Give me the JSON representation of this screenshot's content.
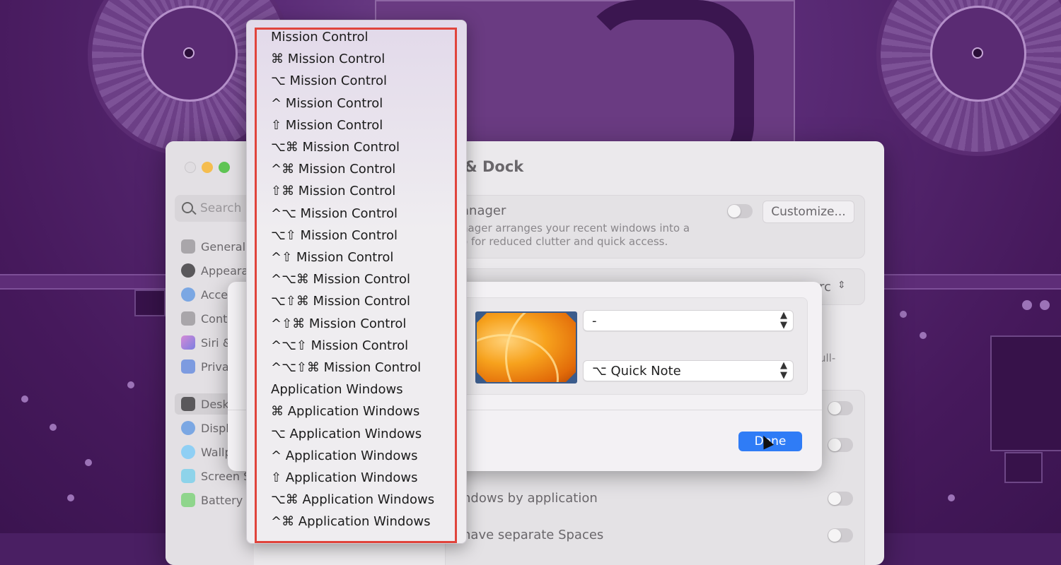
{
  "window": {
    "title": "Desktop & Dock",
    "title_visible": "p & Dock",
    "search_placeholder": "Search",
    "sidebar": [
      {
        "label": "General",
        "icon": "gear-icon",
        "color": "#a9a6aa"
      },
      {
        "label": "Appearance",
        "icon": "appearance-icon",
        "color": "#3c3c3c"
      },
      {
        "label": "Accessibility",
        "icon": "accessibility-icon",
        "color": "#3a86e8"
      },
      {
        "label": "Control Centre",
        "icon": "control-centre-icon",
        "color": "#a9a6aa"
      },
      {
        "label": "Siri & Spotlight",
        "icon": "siri-icon",
        "color": "#b157d8"
      },
      {
        "label": "Privacy & Security",
        "icon": "hand-icon",
        "color": "#4e7fe0"
      },
      {
        "label": "Desktop & Dock",
        "icon": "dock-icon",
        "color": "#3c3c3c"
      },
      {
        "label": "Displays",
        "icon": "display-icon",
        "color": "#3a86e8"
      },
      {
        "label": "Wallpaper",
        "icon": "wallpaper-icon",
        "color": "#56b9f2"
      },
      {
        "label": "Screen Saver",
        "icon": "screen-saver-icon",
        "color": "#55c0e4"
      },
      {
        "label": "Battery",
        "icon": "battery-icon",
        "color": "#56c452"
      }
    ],
    "sidebar_visible": [
      "General",
      "Appeara",
      "Acce",
      "Cont",
      "Siri &",
      "Priva",
      "Desk",
      "Displ",
      "Wallp",
      "Screen S",
      "Battery"
    ],
    "stage_manager": {
      "heading": "anager",
      "desc_line1": "nager arranges your recent windows into a",
      "desc_line2": "o for reduced clutter and quick access.",
      "customize_label": "Customize..."
    },
    "click_row_value": "rc",
    "side_text": "ull-",
    "group_windows_label": "ndows by application",
    "separate_spaces_label": "have separate Spaces"
  },
  "hot_corners": {
    "top_right_value": "-",
    "bottom_right_value": "⌥ Quick Note",
    "done_label": "Done"
  },
  "menu_items": [
    " Mission Control",
    "⌘ Mission Control",
    "⌥ Mission Control",
    "^ Mission Control",
    "⇧ Mission Control",
    "⌥⌘ Mission Control",
    "^⌘ Mission Control",
    "⇧⌘ Mission Control",
    "^⌥ Mission Control",
    "⌥⇧ Mission Control",
    "^⇧ Mission Control",
    "^⌥⌘ Mission Control",
    "⌥⇧⌘ Mission Control",
    "^⇧⌘ Mission Control",
    "^⌥⇧ Mission Control",
    "^⌥⇧⌘ Mission Control",
    " Application Windows",
    "⌘ Application Windows",
    "⌥ Application Windows",
    "^ Application Windows",
    "⇧ Application Windows",
    "⌥⌘ Application Windows",
    "^⌘ Application Windows"
  ],
  "colors": {
    "highlight_border": "#e0443c",
    "done_button": "#2f7cf6",
    "traffic_close": "#e0dde1",
    "traffic_min": "#f5bd4f",
    "traffic_max": "#5fc454"
  }
}
